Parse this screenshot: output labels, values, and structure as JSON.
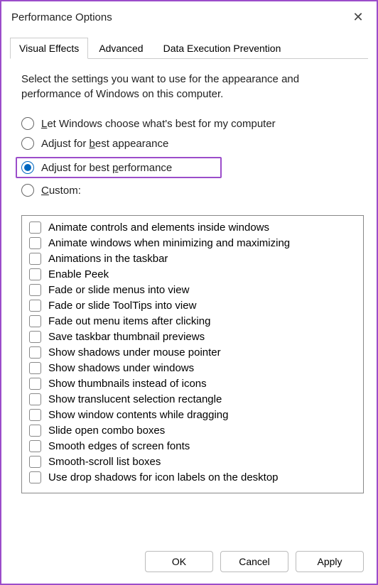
{
  "window": {
    "title": "Performance Options"
  },
  "tabs": {
    "visual_effects": "Visual Effects",
    "advanced": "Advanced",
    "dep": "Data Execution Prevention"
  },
  "description": "Select the settings you want to use for the appearance and performance of Windows on this computer.",
  "radios": {
    "opt1_pre": "",
    "opt1_key": "L",
    "opt1_post": "et Windows choose what's best for my computer",
    "opt2_pre": "Adjust for ",
    "opt2_key": "b",
    "opt2_post": "est appearance",
    "opt3_pre": "Adjust for best ",
    "opt3_key": "p",
    "opt3_post": "erformance",
    "opt4_pre": "",
    "opt4_key": "C",
    "opt4_post": "ustom:"
  },
  "checks": {
    "c1": "Animate controls and elements inside windows",
    "c2": "Animate windows when minimizing and maximizing",
    "c3": "Animations in the taskbar",
    "c4": "Enable Peek",
    "c5": "Fade or slide menus into view",
    "c6": "Fade or slide ToolTips into view",
    "c7": "Fade out menu items after clicking",
    "c8": "Save taskbar thumbnail previews",
    "c9": "Show shadows under mouse pointer",
    "c10": "Show shadows under windows",
    "c11": "Show thumbnails instead of icons",
    "c12": "Show translucent selection rectangle",
    "c13": "Show window contents while dragging",
    "c14": "Slide open combo boxes",
    "c15": "Smooth edges of screen fonts",
    "c16": "Smooth-scroll list boxes",
    "c17": "Use drop shadows for icon labels on the desktop"
  },
  "buttons": {
    "ok": "OK",
    "cancel": "Cancel",
    "apply": "Apply"
  }
}
